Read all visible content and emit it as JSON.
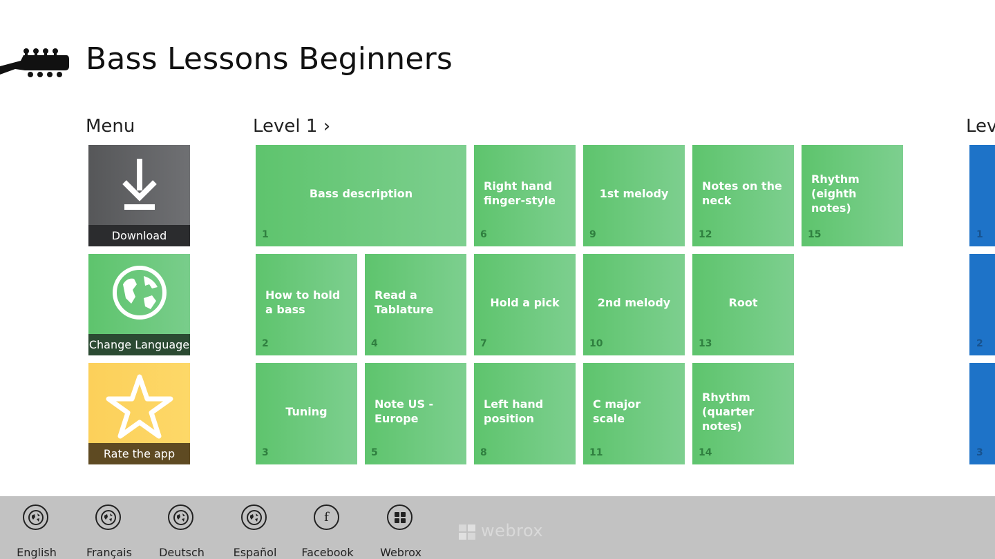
{
  "app": {
    "title": "Bass Lessons Beginners",
    "logo_icon": "bass-headstock-icon"
  },
  "menu": {
    "header": "Menu",
    "items": [
      {
        "label": "Download",
        "icon": "download-icon",
        "color": "#5e5f62"
      },
      {
        "label": "Change Language",
        "icon": "globe-icon",
        "color": "#5ec46d"
      },
      {
        "label": "Rate the app",
        "icon": "star-icon",
        "color": "#fdd25d"
      }
    ]
  },
  "level1": {
    "header": "Level 1 ›",
    "tiles": [
      {
        "title": "Bass description",
        "number": "1"
      },
      {
        "title": "How to hold a bass",
        "number": "2"
      },
      {
        "title": "Tuning",
        "number": "3"
      },
      {
        "title": "Read a Tablature",
        "number": "4"
      },
      {
        "title": "Note US - Europe",
        "number": "5"
      },
      {
        "title": "Right hand finger-style",
        "number": "6"
      },
      {
        "title": "Hold a pick",
        "number": "7"
      },
      {
        "title": "Left hand position",
        "number": "8"
      },
      {
        "title": "1st melody",
        "number": "9"
      },
      {
        "title": "2nd melody",
        "number": "10"
      },
      {
        "title": "C major scale",
        "number": "11"
      },
      {
        "title": "Notes on the neck",
        "number": "12"
      },
      {
        "title": "Root",
        "number": "13"
      },
      {
        "title": "Rhythm (quarter notes)",
        "number": "14"
      },
      {
        "title": "Rhythm (eighth notes)",
        "number": "15"
      }
    ]
  },
  "level2": {
    "header": "Lev",
    "tiles": [
      {
        "number": "1"
      },
      {
        "number": "2"
      },
      {
        "number": "3"
      }
    ]
  },
  "app_bar": {
    "buttons": [
      {
        "label": "English",
        "icon": "globe-icon"
      },
      {
        "label": "Français",
        "icon": "globe-icon"
      },
      {
        "label": "Deutsch",
        "icon": "globe-icon"
      },
      {
        "label": "Español",
        "icon": "globe-icon"
      },
      {
        "label": "Facebook",
        "icon": "facebook-icon",
        "glyph": "f"
      },
      {
        "label": "Webrox",
        "icon": "windows-grid-icon"
      }
    ],
    "watermark": "webrox"
  },
  "colors": {
    "green": "#5ec46d",
    "green_light": "#7dcf8f",
    "blue": "#1e73c8",
    "gray": "#5e5f62",
    "yellow": "#fdd25d",
    "app_bar": "#c2c2c2"
  }
}
